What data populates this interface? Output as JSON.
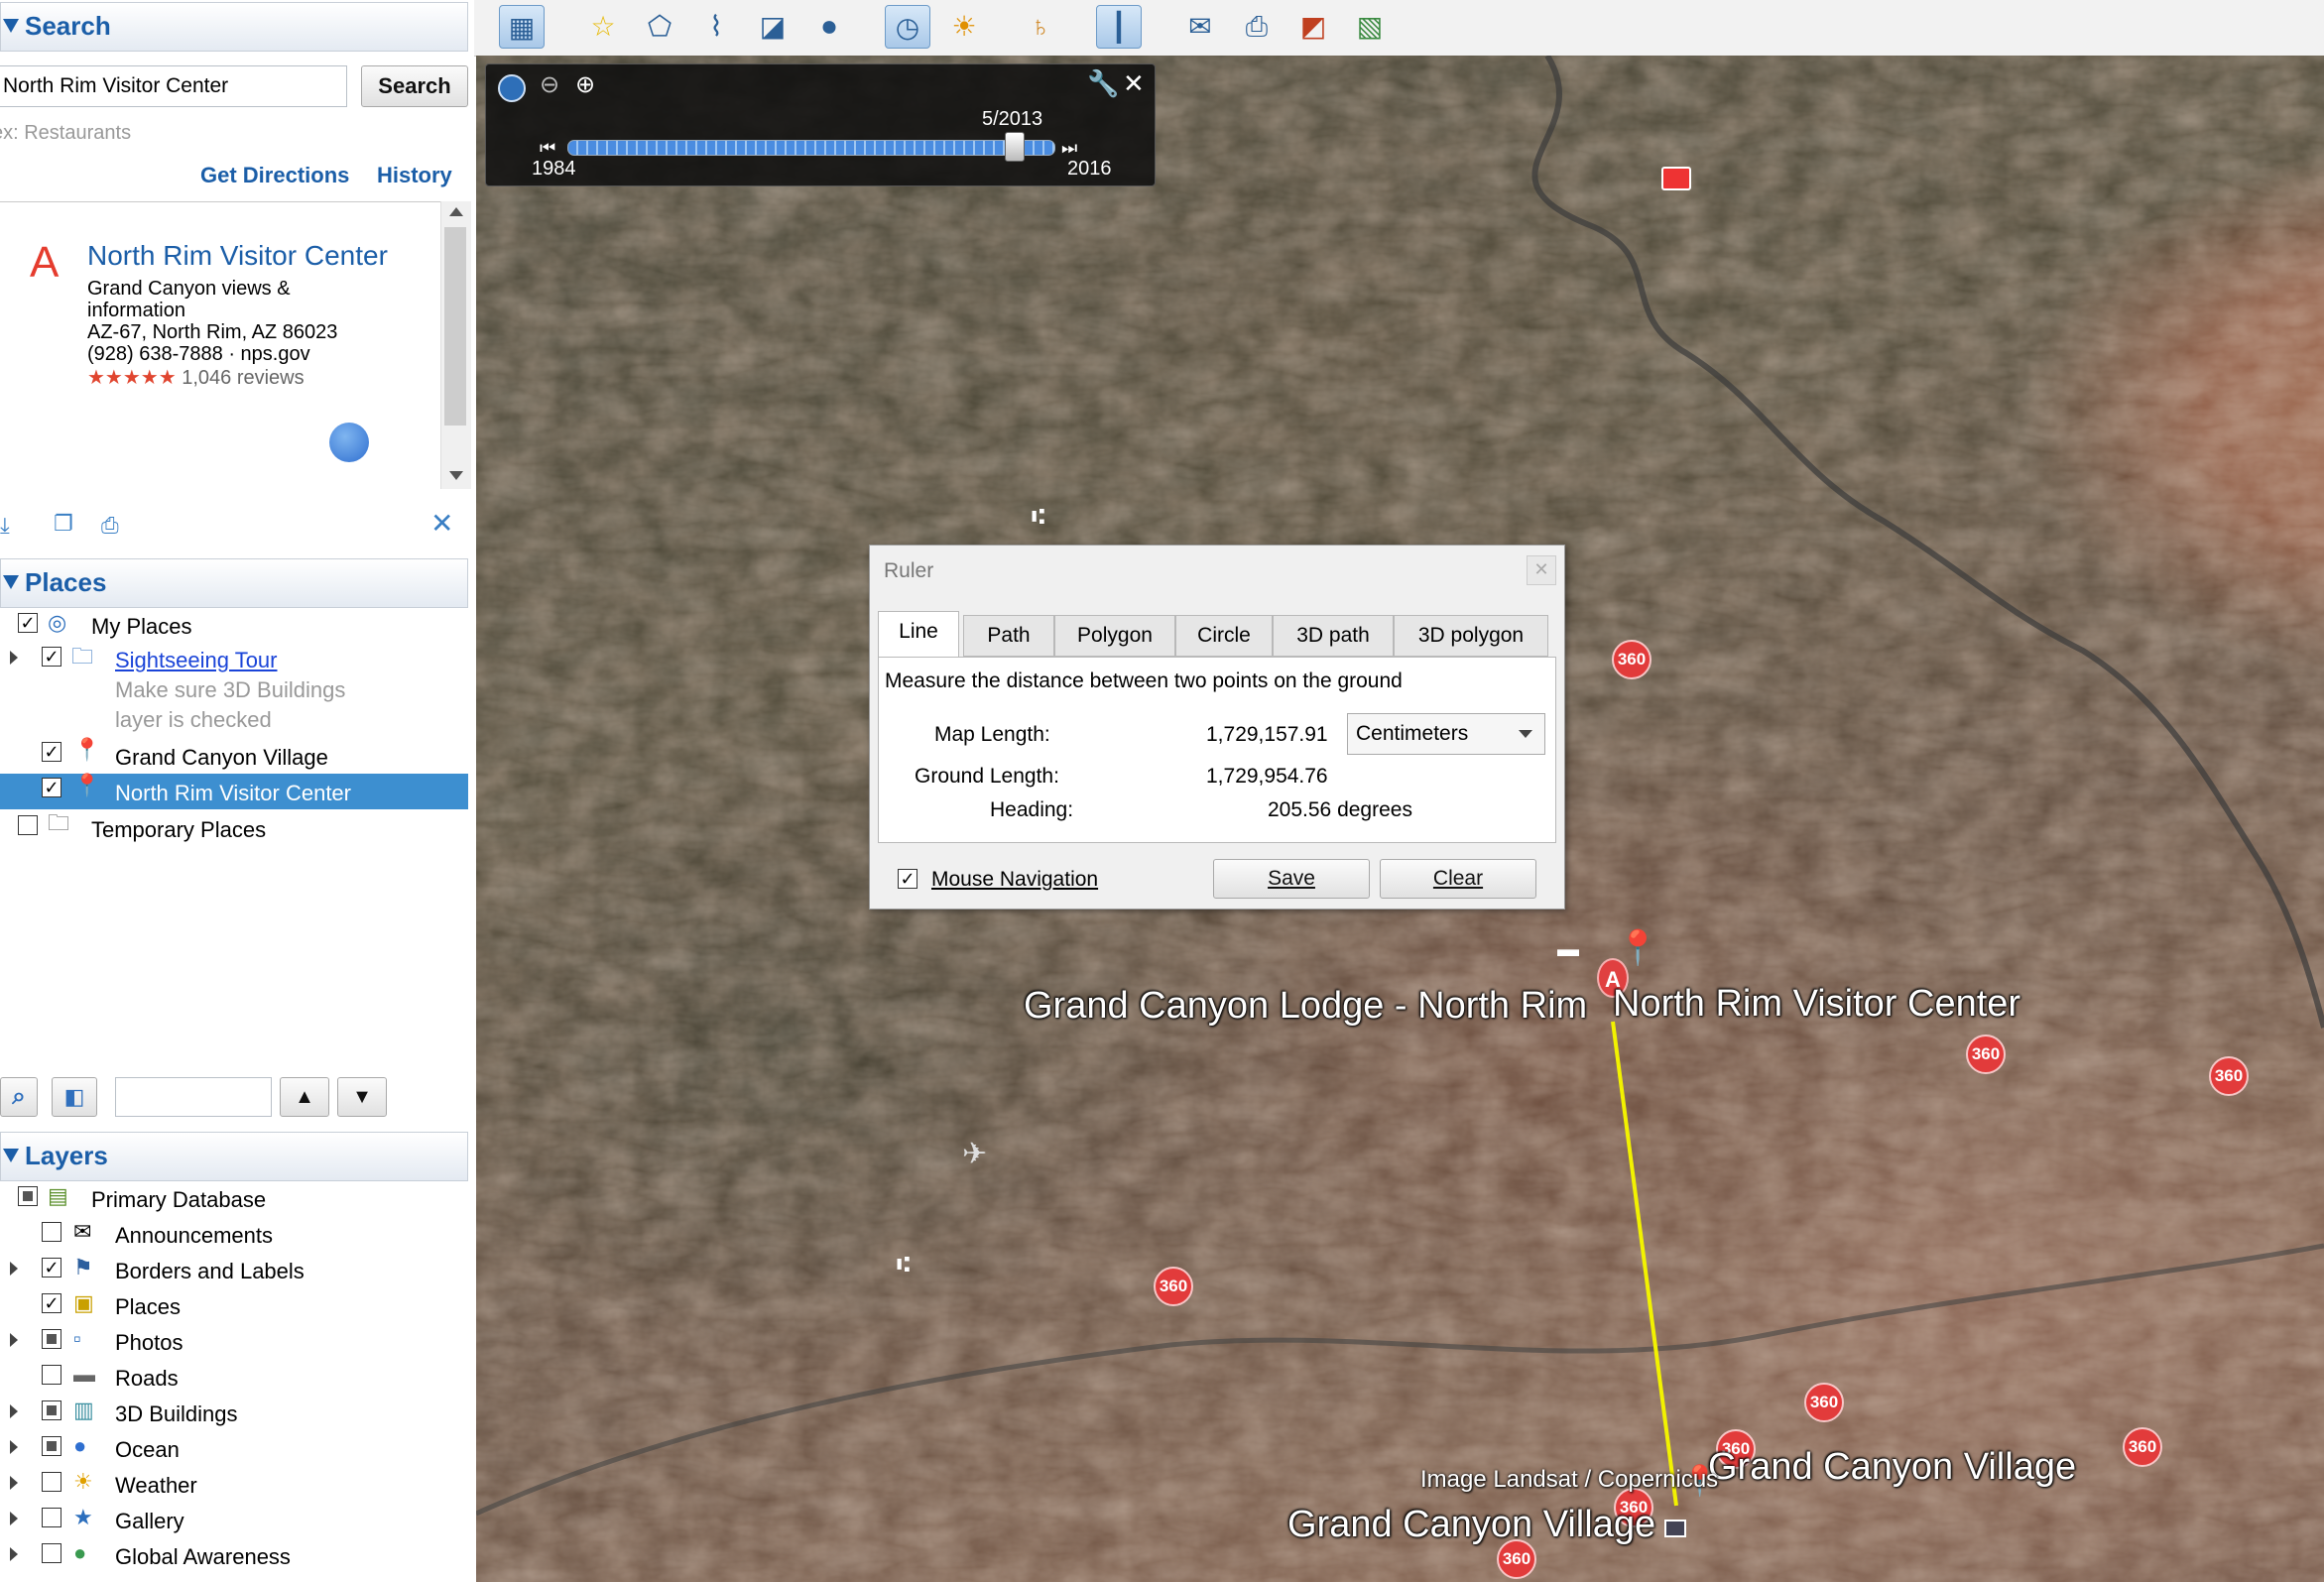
{
  "search": {
    "header": "Search",
    "query": "North Rim Visitor Center",
    "button": "Search",
    "hint": "ex: Restaurants",
    "get_directions": "Get Directions",
    "history": "History"
  },
  "result": {
    "marker": "A",
    "title": "North Rim Visitor Center",
    "desc1": "Grand Canyon views &",
    "desc2": "information",
    "address": "AZ-67, North Rim, AZ 86023",
    "phone": "(928) 638-7888 · nps.gov",
    "stars": "★★★★★",
    "reviews": "1,046 reviews"
  },
  "places": {
    "header": "Places",
    "items": [
      {
        "label": "My Places"
      },
      {
        "label": "Sightseeing Tour"
      },
      {
        "label": "Make sure 3D Buildings"
      },
      {
        "label": "layer is checked"
      },
      {
        "label": "Grand Canyon Village"
      },
      {
        "label": "North Rim Visitor Center"
      },
      {
        "label": "Temporary Places"
      }
    ]
  },
  "layers": {
    "header": "Layers",
    "items": [
      {
        "label": "Primary Database"
      },
      {
        "label": "Announcements"
      },
      {
        "label": "Borders and Labels"
      },
      {
        "label": "Places"
      },
      {
        "label": "Photos"
      },
      {
        "label": "Roads"
      },
      {
        "label": "3D Buildings"
      },
      {
        "label": "Ocean"
      },
      {
        "label": "Weather"
      },
      {
        "label": "Gallery"
      },
      {
        "label": "Global Awareness"
      }
    ]
  },
  "timeslider": {
    "current": "5/2013",
    "start": "1984",
    "end": "2016",
    "position": 0.92
  },
  "ruler": {
    "title": "Ruler",
    "tabs": [
      "Line",
      "Path",
      "Polygon",
      "Circle",
      "3D path",
      "3D polygon"
    ],
    "instruction": "Measure the distance between two points on the ground",
    "map_length_label": "Map Length:",
    "map_length_value": "1,729,157.91",
    "unit": "Centimeters",
    "ground_length_label": "Ground Length:",
    "ground_length_value": "1,729,954.76",
    "heading_label": "Heading:",
    "heading_value": "205.56 degrees",
    "mouse_nav": "Mouse Navigation",
    "save": "Save",
    "clear": "Clear"
  },
  "map": {
    "label_lodge": "Grand Canyon Lodge - North Rim",
    "label_visitor": "North Rim Visitor Center",
    "label_village_right": "Grand Canyon Village",
    "label_village_bottom": "Grand Canyon Village",
    "attribution": "Image Landsat / Copernicus",
    "pin_text": "360",
    "marker": "A"
  },
  "colors": {
    "accent": "#1b5ea8",
    "selection": "#3d8fd0",
    "ruler_line": "#f2f200",
    "pin": "#e23b3b"
  }
}
